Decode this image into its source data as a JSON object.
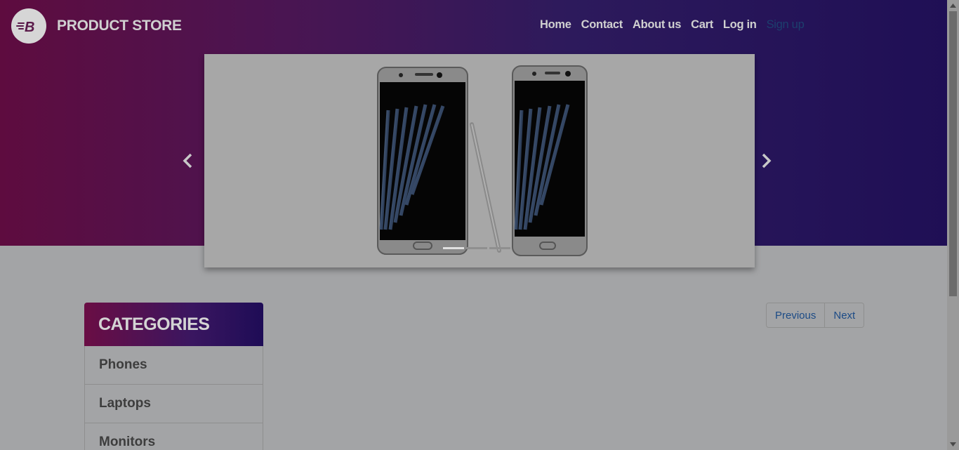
{
  "brand": {
    "name": "PRODUCT STORE",
    "logo_icon": "store-logo-icon"
  },
  "nav": {
    "items": [
      {
        "label": "Home"
      },
      {
        "label": "Contact"
      },
      {
        "label": "About us"
      },
      {
        "label": "Cart"
      },
      {
        "label": "Log in"
      },
      {
        "label": "Sign up"
      }
    ]
  },
  "carousel": {
    "slide_icon": "samsung-phones-image",
    "indicators": 3,
    "active_index": 0
  },
  "categories": {
    "title": "CATEGORIES",
    "items": [
      {
        "label": "Phones"
      },
      {
        "label": "Laptops"
      },
      {
        "label": "Monitors"
      }
    ]
  },
  "pagination": {
    "previous": "Previous",
    "next": "Next"
  },
  "colors": {
    "overlay": "#a3a4a6",
    "gradient_start": "#5e0c3f",
    "gradient_end": "#1f0f55",
    "link": "#1c4b86"
  }
}
